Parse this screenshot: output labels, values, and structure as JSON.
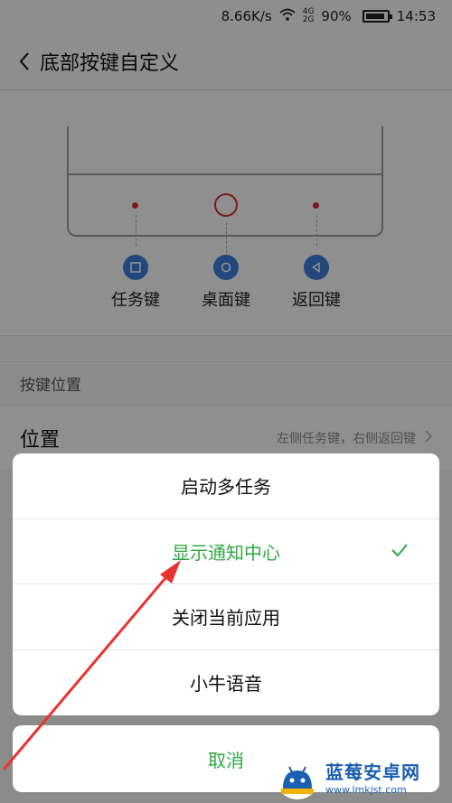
{
  "status_bar": {
    "speed": "8.66K/s",
    "network_top": "4G",
    "network_bottom": "2G",
    "battery_percent": "90%",
    "battery_level": 0.9,
    "time": "14:53"
  },
  "header": {
    "title": "底部按键自定义"
  },
  "preview": {
    "keys": [
      {
        "label": "任务键",
        "icon": "square-icon"
      },
      {
        "label": "桌面键",
        "icon": "circle-icon"
      },
      {
        "label": "返回键",
        "icon": "triangle-back-icon"
      }
    ]
  },
  "section": {
    "title": "按键位置"
  },
  "position_row": {
    "label": "位置",
    "value": "左侧任务键，右侧返回键"
  },
  "action_sheet": {
    "items": [
      {
        "label": "启动多任务",
        "selected": false
      },
      {
        "label": "显示通知中心",
        "selected": true
      },
      {
        "label": "关闭当前应用",
        "selected": false
      },
      {
        "label": "小牛语音",
        "selected": false
      }
    ],
    "cancel_label": "取消"
  },
  "watermark": {
    "title": "蓝莓安卓网",
    "url": "www.lmkjst.com"
  },
  "colors": {
    "accent_green": "#2fa842",
    "key_blue": "#3a7ad6",
    "marker_red": "#d82c2c",
    "arrow_red": "#e8332e"
  }
}
